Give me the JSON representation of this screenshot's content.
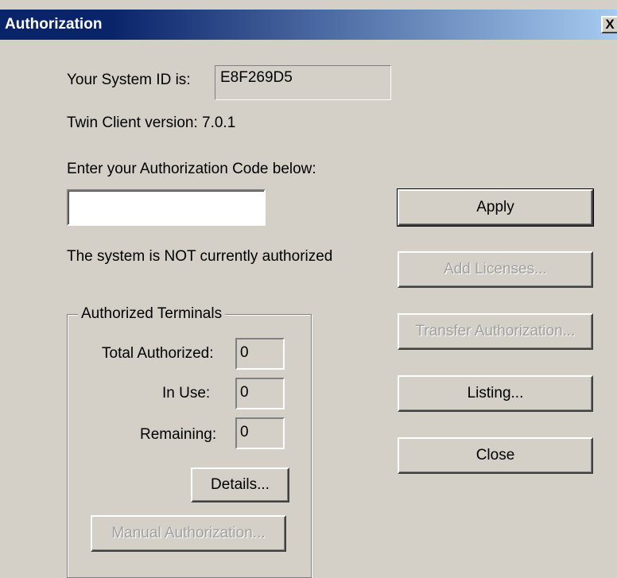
{
  "window": {
    "title": "Authorization",
    "close_glyph": "X"
  },
  "system": {
    "id_label": "Your System ID is:",
    "id_value": "E8F269D5",
    "version_text": "Twin Client version: 7.0.1"
  },
  "auth": {
    "prompt": "Enter your Authorization Code below:",
    "code_value": "",
    "status_text": "The system is NOT currently authorized"
  },
  "terminals": {
    "group_title": "Authorized Terminals",
    "total_label": "Total Authorized:",
    "total_value": "0",
    "in_use_label": "In Use:",
    "in_use_value": "0",
    "remaining_label": "Remaining:",
    "remaining_value": "0",
    "details_label": "Details...",
    "manual_label": "Manual Authorization..."
  },
  "buttons": {
    "apply": "Apply",
    "add_licenses": "Add Licenses...",
    "transfer": "Transfer Authorization...",
    "listing": "Listing...",
    "close": "Close"
  }
}
